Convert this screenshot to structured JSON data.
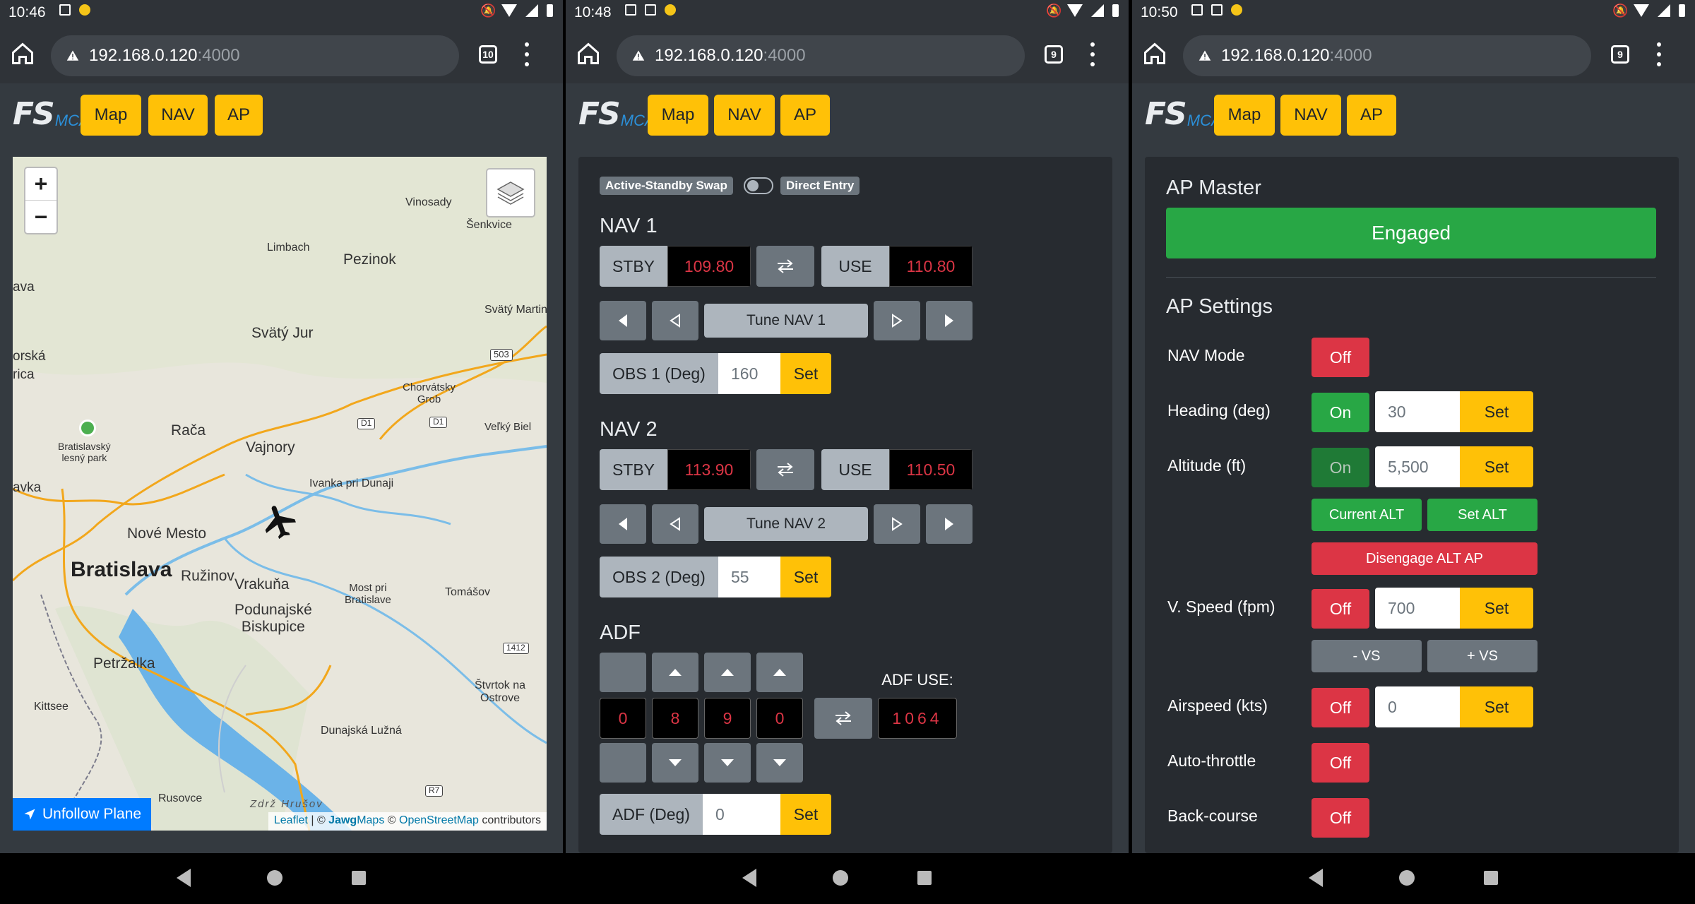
{
  "phone1": {
    "time": "10:46",
    "url_host": "192.168.0.120",
    "url_port": ":4000",
    "tab_count": "10"
  },
  "phone2": {
    "time": "10:48",
    "url_host": "192.168.0.120",
    "url_port": ":4000",
    "tab_count": "9"
  },
  "phone3": {
    "time": "10:50",
    "url_host": "192.168.0.120",
    "url_port": ":4000",
    "tab_count": "9"
  },
  "app": {
    "logo_fs": "FS",
    "logo_mca": "MCA",
    "nav_map": "Map",
    "nav_nav": "NAV",
    "nav_ap": "AP"
  },
  "map": {
    "zoom_in": "+",
    "zoom_out": "−",
    "unfollow_label": "Unfollow Plane",
    "attribution_leaflet": "Leaflet",
    "attribution_sep": " | © ",
    "attribution_jawg": "Jawg",
    "attribution_maps": "Maps",
    "attribution_c": " © ",
    "attribution_osm": "OpenStreetMap",
    "attribution_contrib": " contributors",
    "labels": {
      "vinosady": "Vinosady",
      "senkvice": "Šenkvice",
      "limbach": "Limbach",
      "pezinok": "Pezinok",
      "ava": "ava",
      "svaty_martin": "Svätý Martin",
      "svaty_jur": "Svätý Jur",
      "orska": "orská",
      "rica": "rica",
      "r503": "503",
      "chorvatsky": "Chorvátsky",
      "grob": "Grob",
      "bratislavsky": "Bratislavský",
      "lesny_park": "lesný park",
      "raca": "Rača",
      "d1a": "D1",
      "d1b": "D1",
      "velky_biel": "Veľký Biel",
      "vajnory": "Vajnory",
      "ivanka": "Ivanka pri Dunaji",
      "avka": "avka",
      "nove_mesto": "Nové Mesto",
      "bratislava": "Bratislava",
      "ruzinov": "Ružinov",
      "vrakuna": "Vrakuňa",
      "most": "Most pri",
      "most2": "Bratislave",
      "tomasov": "Tomášov",
      "podunajske": "Podunajské",
      "biskupice": "Biskupice",
      "r1412": "1412",
      "petrzalka": "Petržalka",
      "stvrtok": "Štvrtok na",
      "ostrove": "Ostrove",
      "kittsee": "Kittsee",
      "dunajska": "Dunajská Lužná",
      "rusovce": "Rusovce",
      "zdrz": "Zdrž Hrušov",
      "r7": "R7"
    }
  },
  "nav": {
    "mode_active_standby": "Active-Standby Swap",
    "mode_direct": "Direct Entry",
    "nav1": {
      "title": "NAV 1",
      "stby_label": "STBY",
      "stby_freq": "109.80",
      "use_label": "USE",
      "use_freq": "110.80",
      "tune_label": "Tune NAV 1",
      "obs_label": "OBS 1 (Deg)",
      "obs_value": "160",
      "set_label": "Set"
    },
    "nav2": {
      "title": "NAV 2",
      "stby_label": "STBY",
      "stby_freq": "113.90",
      "use_label": "USE",
      "use_freq": "110.50",
      "tune_label": "Tune NAV 2",
      "obs_label": "OBS 2 (Deg)",
      "obs_value": "55",
      "set_label": "Set"
    },
    "adf": {
      "title": "ADF",
      "digits": [
        "0",
        "8",
        "9",
        "0"
      ],
      "use_label": "ADF USE:",
      "use_value": "1064",
      "deg_label": "ADF (Deg)",
      "deg_value": "0",
      "set_label": "Set"
    }
  },
  "ap": {
    "master_title": "AP Master",
    "engaged_label": "Engaged",
    "settings_title": "AP Settings",
    "nav_mode_label": "NAV Mode",
    "nav_mode_state": "Off",
    "heading_label": "Heading (deg)",
    "heading_state": "On",
    "heading_value": "30",
    "altitude_label": "Altitude (ft)",
    "altitude_state": "On",
    "altitude_value": "5,500",
    "current_alt": "Current ALT",
    "set_alt": "Set ALT",
    "disengage_alt": "Disengage ALT AP",
    "vspeed_label": "V. Speed (fpm)",
    "vspeed_state": "Off",
    "vspeed_value": "700",
    "minus_vs": "- VS",
    "plus_vs": "+ VS",
    "airspeed_label": "Airspeed (kts)",
    "airspeed_state": "Off",
    "airspeed_value": "0",
    "autothrottle_label": "Auto-throttle",
    "autothrottle_state": "Off",
    "backcourse_label": "Back-course",
    "backcourse_state": "Off",
    "set_label": "Set"
  }
}
